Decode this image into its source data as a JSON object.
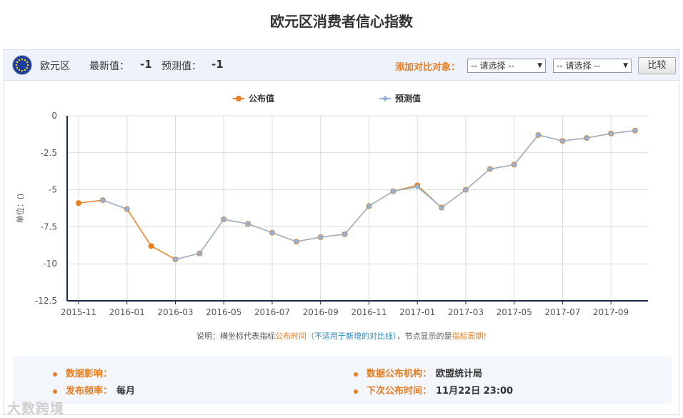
{
  "page": {
    "title": "欧元区消费者信心指数"
  },
  "header": {
    "region": "欧元区",
    "latest_label": "最新值：",
    "latest_value": "-1",
    "forecast_label": "预测值：",
    "forecast_value": "-1",
    "compare_label": "添加对比对象：",
    "select1": "-- 请选择 --",
    "select2": "-- 请选择 --",
    "compare_button": "比较"
  },
  "colors": {
    "published": "#e67e22",
    "forecast": "#8fb3d9",
    "accent": "#e67e22",
    "axis": "#1b2a4a"
  },
  "chart_data": {
    "type": "line",
    "ylabel": "单位：()",
    "ylim": [
      -12.5,
      0
    ],
    "yticks": [
      "0",
      "-2.5",
      "-5",
      "-7.5",
      "-10",
      "-12.5"
    ],
    "ytick_values": [
      0,
      -2.5,
      -5,
      -7.5,
      -10,
      -12.5
    ],
    "xtick_labels": [
      "2015-11",
      "2016-01",
      "2016-03",
      "2016-05",
      "2016-07",
      "2016-09",
      "2016-11",
      "2017-01",
      "2017-03",
      "2017-05",
      "2017-07",
      "2017-09"
    ],
    "x": [
      "2015-11",
      "2015-12",
      "2016-01",
      "2016-02",
      "2016-03",
      "2016-04",
      "2016-05",
      "2016-06",
      "2016-07",
      "2016-08",
      "2016-09",
      "2016-10",
      "2016-11",
      "2016-12",
      "2017-01",
      "2017-02",
      "2017-03",
      "2017-04",
      "2017-05",
      "2017-06",
      "2017-07",
      "2017-08",
      "2017-09",
      "2017-10"
    ],
    "grid": true,
    "legend_position": "top-center",
    "series": [
      {
        "name": "公布值",
        "values": [
          -5.9,
          -5.7,
          -6.3,
          -8.8,
          -9.7,
          -9.3,
          -7.0,
          -7.3,
          -7.9,
          -8.5,
          -8.2,
          -8.0,
          -6.1,
          -5.1,
          -4.7,
          -6.2,
          -5.0,
          -3.6,
          -3.3,
          -1.3,
          -1.7,
          -1.5,
          -1.2,
          -1.0
        ]
      },
      {
        "name": "预测值",
        "values": [
          null,
          -5.7,
          -6.3,
          null,
          -9.7,
          -9.3,
          -7.0,
          -7.3,
          -7.9,
          -8.5,
          -8.2,
          -8.0,
          -6.1,
          -5.1,
          -4.8,
          -6.2,
          -5.0,
          -3.6,
          -3.3,
          -1.3,
          -1.7,
          -1.5,
          -1.2,
          -1.0
        ]
      }
    ]
  },
  "note": {
    "prefix": "说明：横坐标代表指标",
    "publish_time": "公布时间",
    "paren": "（不适用于新增的对比线）",
    "middle": "，节点显示的是",
    "cycle": "指标周期",
    "suffix": "!"
  },
  "info": {
    "impact_label": "数据影响：",
    "impact_value": "",
    "freq_label": "发布频率：",
    "freq_value": "每月",
    "agency_label": "数据公布机构：",
    "agency_value": "欧盟统计局",
    "next_label": "下次公布时间：",
    "next_value": "11月22日 23:00"
  },
  "watermark": "大数跨境"
}
